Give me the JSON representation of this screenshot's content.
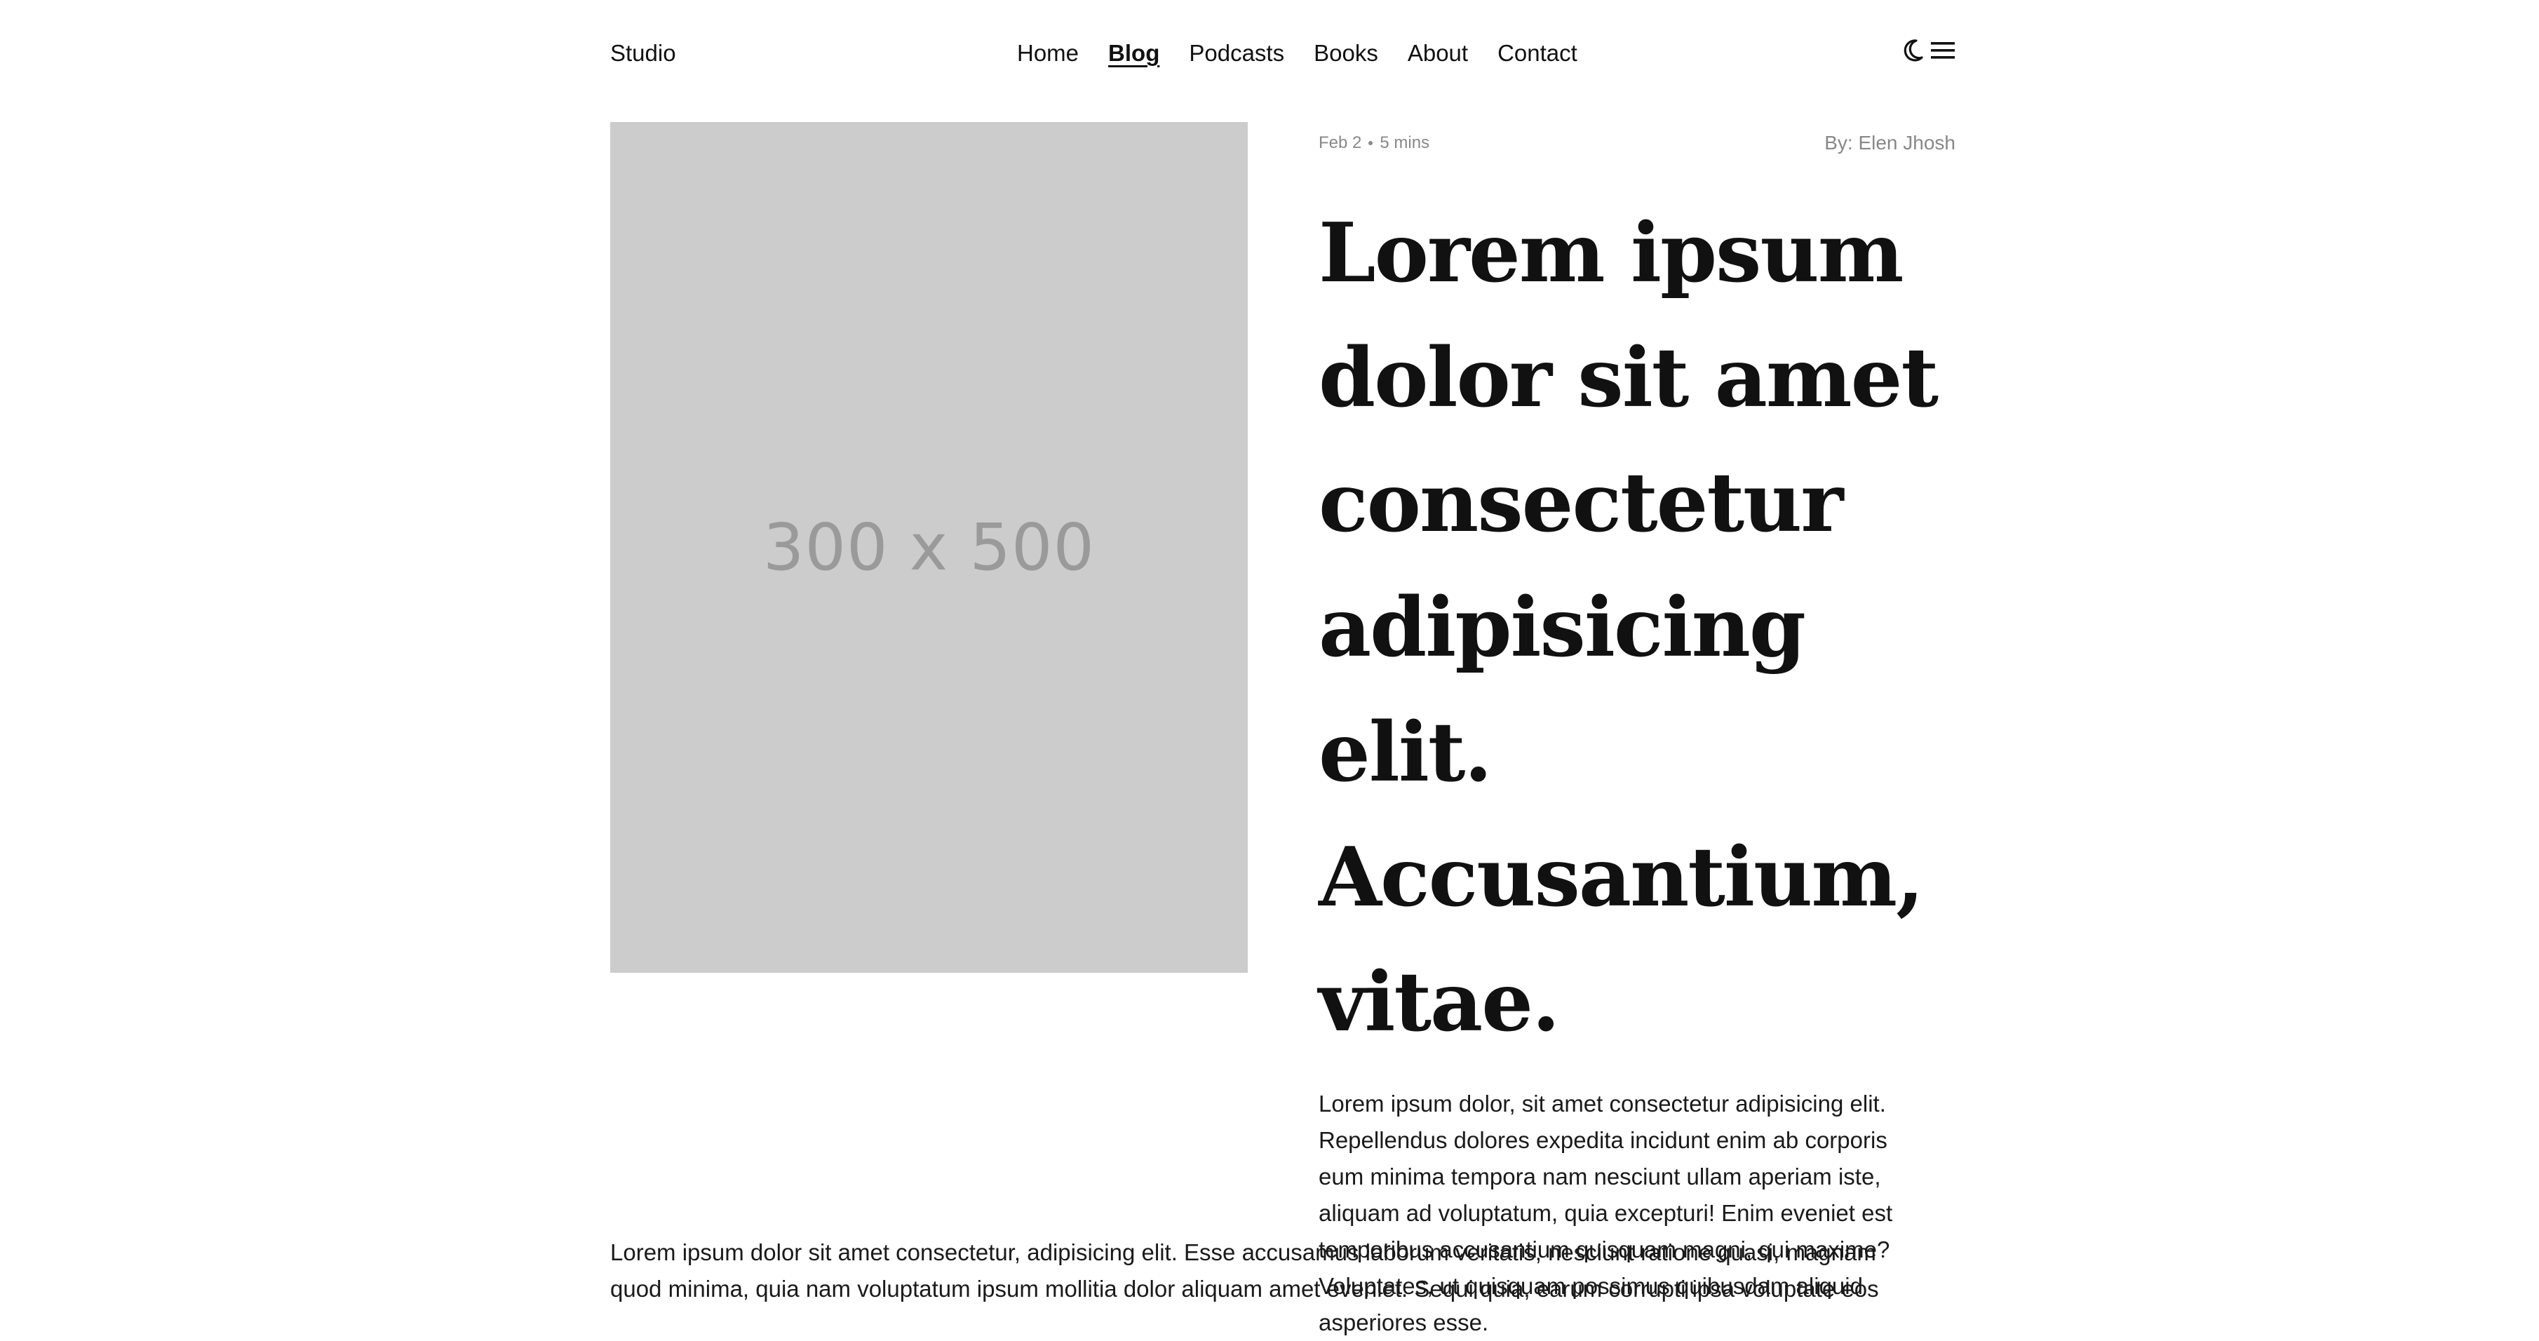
{
  "header": {
    "brand": "Studio",
    "nav": [
      {
        "label": "Home",
        "active": false
      },
      {
        "label": "Blog",
        "active": true
      },
      {
        "label": "Podcasts",
        "active": false
      },
      {
        "label": "Books",
        "active": false
      },
      {
        "label": "About",
        "active": false
      },
      {
        "label": "Contact",
        "active": false
      }
    ],
    "icons": [
      "moon-icon",
      "menu-icon"
    ]
  },
  "hero": {
    "placeholder_text": "300 x 500"
  },
  "article": {
    "date": "Feb 2",
    "read_time": "5 mins",
    "author": "By: Elen Jhosh",
    "title": "Lorem ipsum dolor sit amet consectetur adipisicing elit. Accusantium, vitae.",
    "lead": "Lorem ipsum dolor, sit amet consectetur adipisicing elit. Repellendus dolores expedita incidunt enim ab corporis eum minima tempora nam nesciunt ullam aperiam iste, aliquam ad voluptatum, quia excepturi! Enim eveniet est temporibus accusantium quisquam magni, qui maxime? Voluptates, ut quisquam possimus quibusdam aliquid asperiores esse.",
    "body": "Lorem ipsum dolor sit amet consectetur, adipisicing elit. Esse accusamus laborum veritatis, nesciunt ratione quasi, magnam quod minima, quia nam voluptatum ipsum mollitia dolor aliquam amet eveniet. Sequi quia, earum corrupti ipsa voluptate eos"
  },
  "colors": {
    "text": "#111111",
    "muted": "#888888",
    "placeholder_bg": "#cccccc",
    "placeholder_text": "#9a9a9a"
  }
}
